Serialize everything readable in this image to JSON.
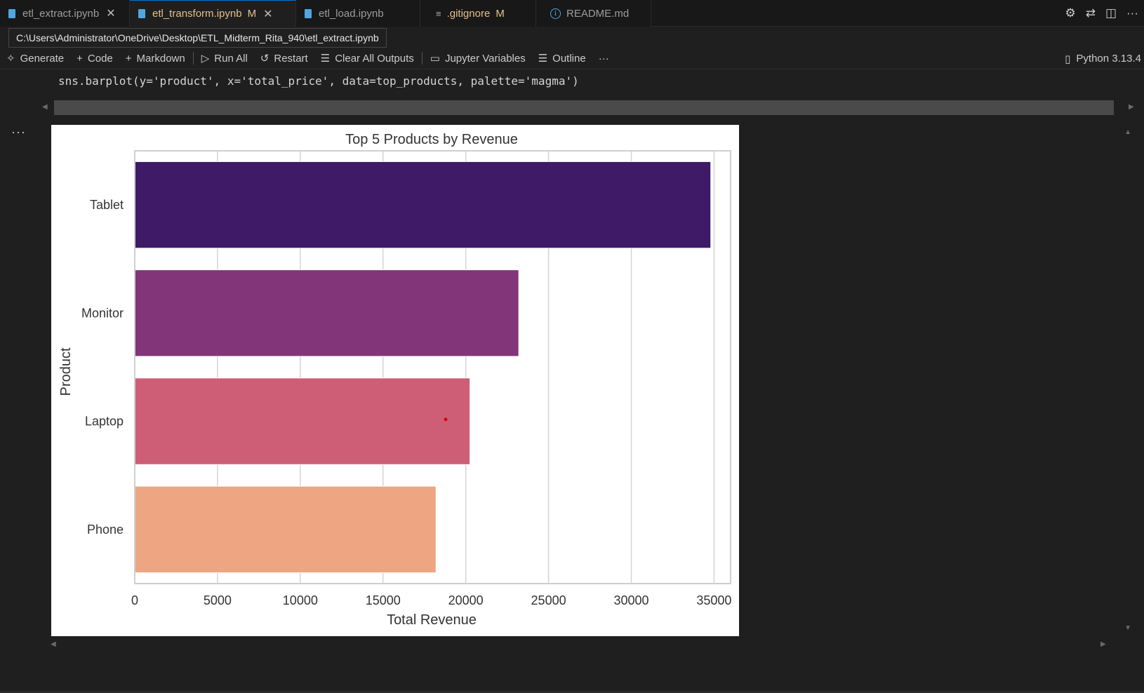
{
  "tabs": [
    {
      "label": "etl_extract.ipynb",
      "modified": "",
      "close": "✕",
      "active": false
    },
    {
      "label": "etl_transform.ipynb",
      "modified": "M",
      "close": "✕",
      "active": true
    },
    {
      "label": "etl_load.ipynb",
      "modified": "",
      "close": "",
      "active": false
    },
    {
      "label": ".gitignore",
      "modified": "M",
      "close": "",
      "active": false
    },
    {
      "label": "README.md",
      "modified": "",
      "close": "",
      "active": false
    }
  ],
  "tooltip": "C:\\Users\\Administrator\\OneDrive\\Desktop\\ETL_Midterm_Rita_940\\etl_extract.ipynb",
  "toolbar": {
    "generate": "Generate",
    "code": "Code",
    "markdown": "Markdown",
    "run_all": "Run All",
    "restart": "Restart",
    "clear_outputs": "Clear All Outputs",
    "variables": "Jupyter Variables",
    "outline": "Outline",
    "more": "···",
    "kernel": "Python 3.13.4"
  },
  "code": "sns.barplot(y='product', x='total_price', data=top_products, palette='magma')",
  "cell_more": "···",
  "chart_data": {
    "type": "bar",
    "orientation": "horizontal",
    "title": "Top 5 Products by Revenue",
    "xlabel": "Total Revenue",
    "ylabel": "Product",
    "categories": [
      "Tablet",
      "Monitor",
      "Laptop",
      "Phone"
    ],
    "values": [
      34800,
      23200,
      20250,
      18200
    ],
    "colors": [
      "#3f1a67",
      "#823578",
      "#cd5e76",
      "#eda681"
    ],
    "xlim": [
      0,
      36000
    ],
    "xticks": [
      0,
      5000,
      10000,
      15000,
      20000,
      25000,
      30000,
      35000
    ],
    "grid": true
  }
}
